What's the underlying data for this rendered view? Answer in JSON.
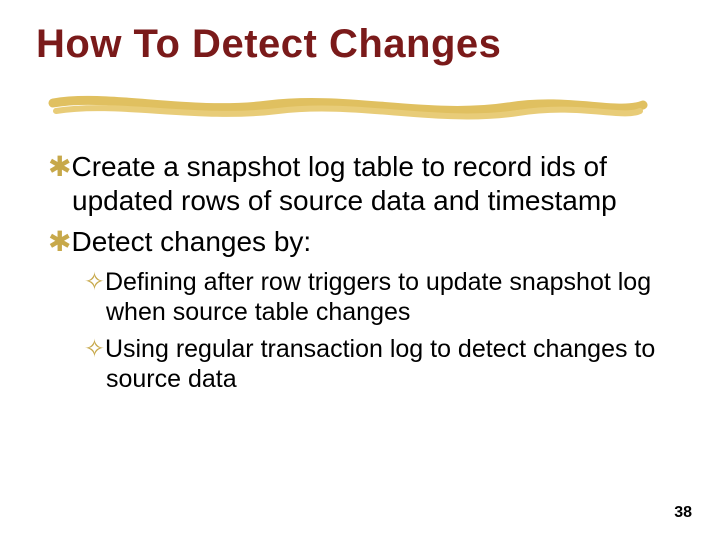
{
  "title": "How To Detect Changes",
  "bullets": {
    "l1a": "Create a snapshot log table to record ids of  updated rows  of source data and timestamp",
    "l1b": "Detect changes by:",
    "l2a": "Defining after row triggers to update snapshot log when source table changes",
    "l2b": "Using regular transaction log to detect changes to source data"
  },
  "glyphs": {
    "z": "✱",
    "y": "✧"
  },
  "page_number": "38"
}
